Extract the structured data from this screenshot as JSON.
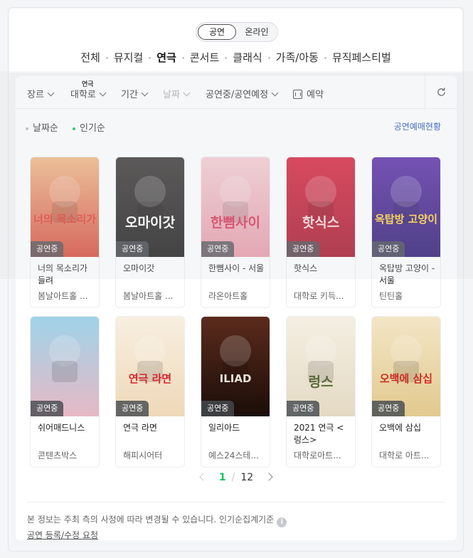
{
  "segment": {
    "active": "공연",
    "inactive": "온라인"
  },
  "categories": [
    {
      "label": "전체",
      "active": false
    },
    {
      "label": "뮤지컬",
      "active": false
    },
    {
      "label": "연극",
      "active": true
    },
    {
      "label": "콘서트",
      "active": false
    },
    {
      "label": "클래식",
      "active": false
    },
    {
      "label": "가족/아동",
      "active": false
    },
    {
      "label": "뮤직페스티벌",
      "active": false
    }
  ],
  "filters": {
    "genre": "장르",
    "region_hint": "연극",
    "region": "대학로",
    "period": "기간",
    "date": "날짜",
    "status": "공연중/공연예정",
    "reserve": "예약"
  },
  "sort": {
    "by_date": "날짜순",
    "by_popular": "인기순",
    "accent": "#03c75a"
  },
  "ticket_link": "공연예매현황",
  "badge_label": "공연중",
  "posters": [
    {
      "title": "너의 목소리가 들려",
      "venue": "봄날아트홀 ...",
      "colors": [
        "#f2b885",
        "#d64a3a"
      ],
      "poster_text": "너의 목소리가",
      "text_color": "#e23b2e"
    },
    {
      "title": "오마이갓",
      "venue": "봄날아트홀 ...",
      "colors": [
        "#3a3534",
        "#1c1a1a"
      ],
      "poster_text": "오마이갓",
      "text_color": "#ffffff"
    },
    {
      "title": "한뼘사이 - 서울",
      "venue": "라온아트홀",
      "colors": [
        "#f5ccd2",
        "#e79aa8"
      ],
      "poster_text": "한뼘사이",
      "text_color": "#d93355"
    },
    {
      "title": "핫식스",
      "venue": "대학로 키득...",
      "colors": [
        "#d9213b",
        "#a5142a"
      ],
      "poster_text": "핫식스",
      "text_color": "#ffd7da"
    },
    {
      "title": "옥탑방 고양이 - 서울",
      "venue": "틴틴홀",
      "colors": [
        "#5a2ca8",
        "#2a1670"
      ],
      "poster_text": "옥탑방 고양이",
      "text_color": "#ffd23a"
    },
    {
      "title": "쉬어매드니스",
      "venue": "콘텐츠박스",
      "colors": [
        "#9fd3e8",
        "#e7b9c6"
      ],
      "poster_text": "",
      "text_color": "#ffffff"
    },
    {
      "title": "연극 라면",
      "venue": "해피시어터",
      "colors": [
        "#f7efe0",
        "#efd8b8"
      ],
      "poster_text": "연극 라면",
      "text_color": "#d8272f"
    },
    {
      "title": "일리아드",
      "venue": "예스24스테...",
      "colors": [
        "#5b2b1c",
        "#1a0d08"
      ],
      "poster_text": "ILIAD",
      "text_color": "#e9e2d8"
    },
    {
      "title": "2021 연극 <렁스>",
      "venue": "대학로아트...",
      "colors": [
        "#f4efe2",
        "#e4dac4"
      ],
      "poster_text": "렁스",
      "text_color": "#5a6b3a"
    },
    {
      "title": "오백에 삼십",
      "venue": "대학로 아트...",
      "colors": [
        "#f3e6c6",
        "#e2c98e"
      ],
      "poster_text": "오백에 삼십",
      "text_color": "#cf2d26"
    }
  ],
  "pagination": {
    "current": "1",
    "separator": "/",
    "total": "12"
  },
  "footer_note": "본 정보는 주최 측의 사정에 따라 변경될 수 있습니다. 인기순집계기준",
  "register_link": "공연 등록/수정 요청"
}
